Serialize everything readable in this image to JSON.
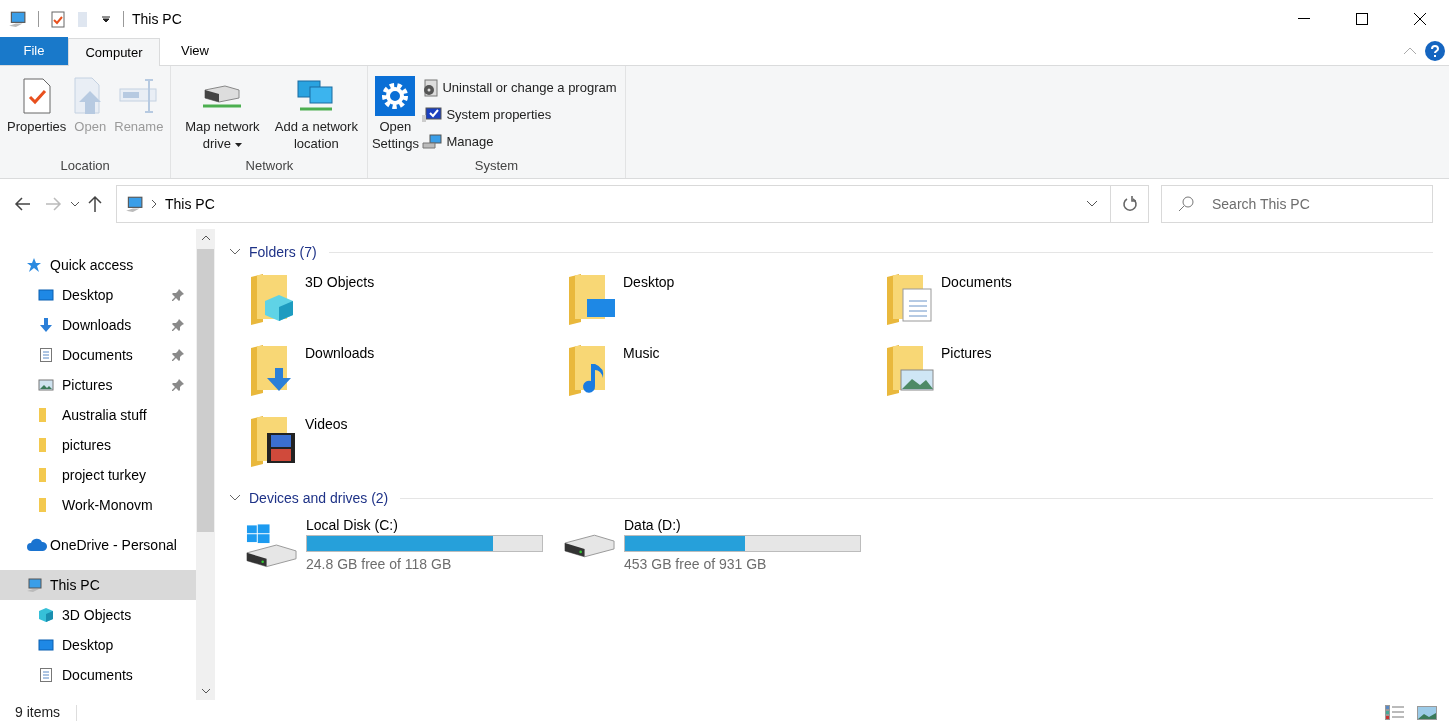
{
  "window": {
    "title": "This PC"
  },
  "tabs": [
    {
      "label": "File",
      "kind": "file",
      "selected": false
    },
    {
      "label": "Computer",
      "kind": "tab",
      "selected": true
    },
    {
      "label": "View",
      "kind": "tab",
      "selected": false
    }
  ],
  "ribbon": {
    "groups": [
      {
        "label": "Location",
        "buttons": [
          {
            "kind": "properties",
            "label": "Properties",
            "disabled": false
          },
          {
            "kind": "open",
            "label": "Open",
            "disabled": true
          },
          {
            "kind": "rename",
            "label": "Rename",
            "disabled": true
          }
        ]
      },
      {
        "label": "Network",
        "buttons": [
          {
            "kind": "map",
            "label": "Map network drive",
            "dropdown": true,
            "disabled": false
          },
          {
            "kind": "addnet",
            "label": "Add a network location",
            "disabled": false
          }
        ]
      },
      {
        "label": "System",
        "buttons": [
          {
            "kind": "settings",
            "label": "Open Settings",
            "disabled": false
          }
        ],
        "small_buttons": [
          {
            "kind": "uninstall",
            "label": "Uninstall or change a program"
          },
          {
            "kind": "sysprops",
            "label": "System properties"
          },
          {
            "kind": "manage",
            "label": "Manage"
          }
        ]
      }
    ]
  },
  "address": {
    "path": "This PC",
    "search_placeholder": "Search This PC"
  },
  "sidebar": {
    "items": [
      {
        "label": "Quick access",
        "kind": "star",
        "selected": false,
        "children": [
          {
            "label": "Desktop",
            "kind": "desktop",
            "pinned": true,
            "selected": false
          },
          {
            "label": "Downloads",
            "kind": "downloads",
            "pinned": true,
            "selected": false
          },
          {
            "label": "Documents",
            "kind": "documents",
            "pinned": true,
            "selected": false
          },
          {
            "label": "Pictures",
            "kind": "pictures",
            "pinned": true,
            "selected": false
          },
          {
            "label": "Australia stuff",
            "kind": "folder",
            "pinned": false,
            "selected": false
          },
          {
            "label": "pictures",
            "kind": "folder",
            "pinned": false,
            "selected": false
          },
          {
            "label": "project turkey",
            "kind": "folder",
            "pinned": false,
            "selected": false
          },
          {
            "label": "Work-Monovm",
            "kind": "folder",
            "pinned": false,
            "selected": false
          }
        ]
      },
      {
        "label": "OneDrive - Personal",
        "kind": "cloud",
        "selected": false
      },
      {
        "label": "This PC",
        "kind": "pc",
        "selected": true,
        "children": [
          {
            "label": "3D Objects",
            "kind": "cube",
            "pinned": false,
            "selected": false
          },
          {
            "label": "Desktop",
            "kind": "desktop",
            "pinned": false,
            "selected": false
          },
          {
            "label": "Documents",
            "kind": "documents",
            "pinned": false,
            "selected": false
          }
        ]
      }
    ]
  },
  "folders": {
    "heading": "Folders (7)",
    "expanded": true,
    "items": [
      {
        "label": "3D Objects",
        "kind": "cube"
      },
      {
        "label": "Desktop",
        "kind": "desktop"
      },
      {
        "label": "Documents",
        "kind": "documents"
      },
      {
        "label": "Downloads",
        "kind": "downloads"
      },
      {
        "label": "Music",
        "kind": "music"
      },
      {
        "label": "Pictures",
        "kind": "pictures"
      },
      {
        "label": "Videos",
        "kind": "videos"
      }
    ]
  },
  "drives": {
    "heading": "Devices and drives (2)",
    "expanded": true,
    "items": [
      {
        "label": "Local Disk (C:)",
        "kind": "windows",
        "level": 0.79,
        "free": "24.8 GB free of 118 GB"
      },
      {
        "label": "Data (D:)",
        "kind": "plain",
        "level": 0.51,
        "free": "453 GB free of 931 GB"
      }
    ]
  },
  "status_bar": {
    "count": "9 items"
  }
}
